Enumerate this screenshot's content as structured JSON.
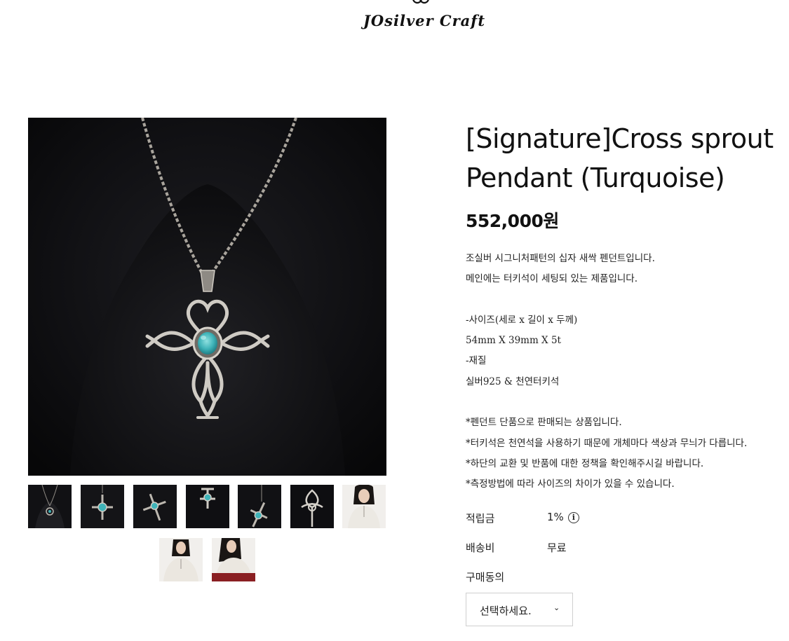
{
  "brand": {
    "logo_text": "JOsilver Craft"
  },
  "product": {
    "title_line1": "[Signature]Cross sprout",
    "title_line2": "Pendant (Turquoise)",
    "price": "552,000원",
    "description": [
      "조실버 시그니처패턴의 십자 새싹 펜던트입니다.",
      "메인에는 터키석이 세팅되 있는 제품입니다.",
      "",
      "-사이즈(세로 x 길이 x 두께)",
      "54mm X 39mm X 5t",
      "-재질",
      "실버925 & 천연터키석",
      "",
      "*펜던트 단품으로 판매되는 상품입니다.",
      "*터키석은 천연석을 사용하기 때문에 개체마다 색상과 무늬가 다릅니다.",
      "*하단의 교환 및 반품에 대한 정책을 확인해주시길 바랍니다.",
      "*측정방법에 따라 사이즈의 차이가 있을 수 있습니다."
    ],
    "points_label": "적립금",
    "points_value": "1%",
    "points_info_icon": "i",
    "shipping_label": "배송비",
    "shipping_value": "무료",
    "agreement_label": "구매동의",
    "select_placeholder": "선택하세요.",
    "select_chevron": "⌄"
  },
  "gallery": {
    "thumbnails": [
      "pendant-front-thumb",
      "pendant-closeup-thumb",
      "pendant-angle-thumb",
      "pendant-top-thumb",
      "pendant-side-thumb",
      "pendant-back-thumb",
      "model-wearing-thumb",
      "model-wearing-2-thumb",
      "model-wearing-3-thumb"
    ]
  },
  "colors": {
    "turquoise": "#3fb3b8",
    "silver": "#c9c6c0",
    "velvet": "#0c0c0e"
  }
}
